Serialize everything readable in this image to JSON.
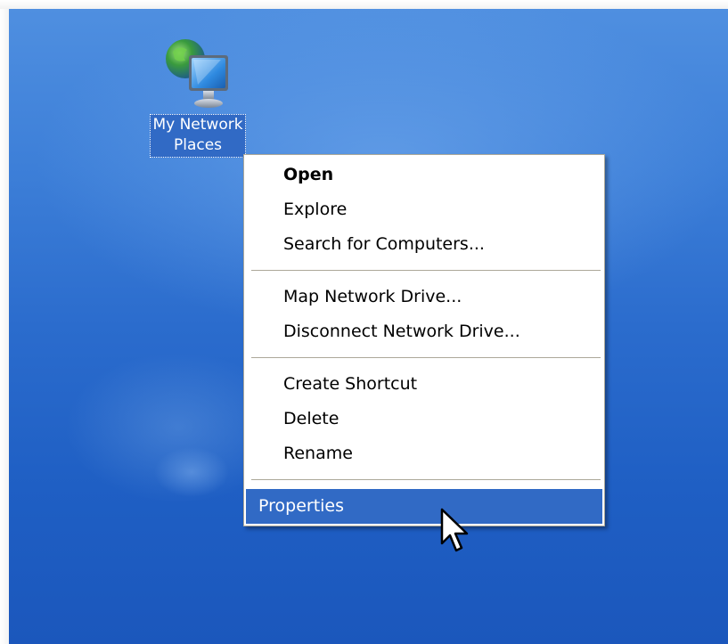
{
  "desktop": {
    "icon": {
      "name": "My Network Places",
      "label_line1": "My Network",
      "label_line2": "Places",
      "icon": "network-places-icon"
    }
  },
  "context_menu": {
    "groups": [
      [
        {
          "label": "Open",
          "bold": true
        },
        {
          "label": "Explore"
        },
        {
          "label": "Search for Computers..."
        }
      ],
      [
        {
          "label": "Map Network Drive..."
        },
        {
          "label": "Disconnect Network Drive..."
        }
      ],
      [
        {
          "label": "Create Shortcut"
        },
        {
          "label": "Delete"
        },
        {
          "label": "Rename"
        }
      ],
      [
        {
          "label": "Properties",
          "highlighted": true
        }
      ]
    ]
  },
  "colors": {
    "selection": "#316ac5",
    "menu_border": "#aca899",
    "desktop_blue": "#2b6ccd"
  }
}
